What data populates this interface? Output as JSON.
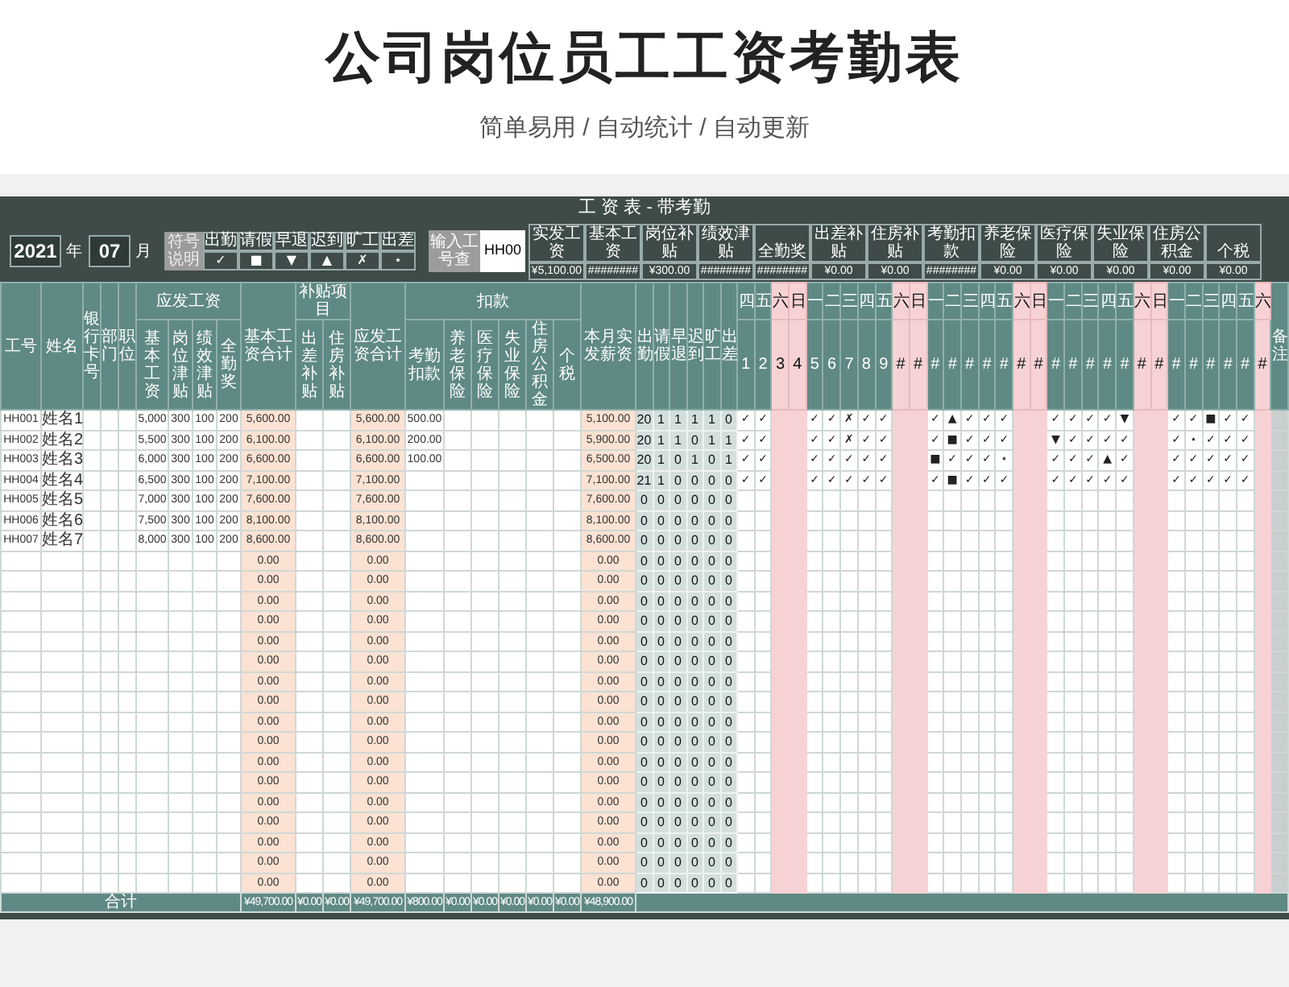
{
  "page_title": "公司岗位员工工资考勤表",
  "subtitle": "简单易用 / 自动统计 / 自动更新",
  "sheet": {
    "title": "工 资 表 - 带考勤",
    "year": "2021",
    "year_unit": "年",
    "month": "07",
    "month_unit": "月",
    "legend_title": "符号说明",
    "legend": [
      {
        "label": "出勤",
        "symbol": "✓"
      },
      {
        "label": "请假",
        "symbol": "■"
      },
      {
        "label": "早退",
        "symbol": "▼"
      },
      {
        "label": "迟到",
        "symbol": "▲"
      },
      {
        "label": "旷工",
        "symbol": "✗"
      },
      {
        "label": "出差",
        "symbol": "⋆"
      }
    ],
    "lookup": {
      "label": "输入工号查",
      "value": "HH00"
    },
    "summary": [
      {
        "label": "实发工资",
        "value": "¥5,100.00"
      },
      {
        "label": "基本工资",
        "value": "########"
      },
      {
        "label": "岗位补贴",
        "value": "¥300.00"
      },
      {
        "label": "绩效津贴",
        "value": "########"
      },
      {
        "label": "全勤奖",
        "value": "########"
      },
      {
        "label": "出差补贴",
        "value": "¥0.00"
      },
      {
        "label": "住房补贴",
        "value": "¥0.00"
      },
      {
        "label": "考勤扣款",
        "value": "########"
      },
      {
        "label": "养老保险",
        "value": "¥0.00"
      },
      {
        "label": "医疗保险",
        "value": "¥0.00"
      },
      {
        "label": "失业保险",
        "value": "¥0.00"
      },
      {
        "label": "住房公积金",
        "value": "¥0.00"
      },
      {
        "label": "个税",
        "value": "¥0.00"
      }
    ],
    "columns": [
      {
        "label": "工号",
        "kind": "plain"
      },
      {
        "label": "姓名",
        "kind": "plain"
      },
      {
        "label": "银行卡号",
        "kind": "plain"
      },
      {
        "label": "部门",
        "kind": "plain"
      },
      {
        "label": "职位",
        "kind": "plain"
      },
      {
        "label": "应发工资",
        "kind": "group",
        "columns": [
          {
            "label": "基本工资",
            "kind": "plain"
          },
          {
            "label": "岗位津贴",
            "kind": "plain"
          },
          {
            "label": "绩效津贴",
            "kind": "plain"
          },
          {
            "label": "全勤奖",
            "kind": "plain"
          }
        ]
      },
      {
        "label": "基本工资合计",
        "kind": "total"
      },
      {
        "label": "补贴项目",
        "kind": "group",
        "columns": [
          {
            "label": "出差补贴",
            "kind": "plain"
          },
          {
            "label": "住房补贴",
            "kind": "plain"
          }
        ]
      },
      {
        "label": "应发工资合计",
        "kind": "total"
      },
      {
        "label": "扣款",
        "kind": "group",
        "columns": [
          {
            "label": "考勤扣款",
            "kind": "plain"
          },
          {
            "label": "养老保险",
            "kind": "plain"
          },
          {
            "label": "医疗保险",
            "kind": "plain"
          },
          {
            "label": "失业保险",
            "kind": "plain"
          },
          {
            "label": "住房公积金",
            "kind": "plain"
          },
          {
            "label": "个税",
            "kind": "plain"
          }
        ]
      },
      {
        "label": "本月实发薪资",
        "kind": "total"
      }
    ],
    "count_columns": [
      {
        "label": "出勤"
      },
      {
        "label": "请假"
      },
      {
        "label": "早退"
      },
      {
        "label": "迟到"
      },
      {
        "label": "旷工"
      },
      {
        "label": "出差"
      }
    ],
    "days": [
      {
        "weekday": "四",
        "day": "1",
        "weekend": false
      },
      {
        "weekday": "五",
        "day": "2",
        "weekend": false
      },
      {
        "weekday": "六",
        "day": "3",
        "weekend": true
      },
      {
        "weekday": "日",
        "day": "4",
        "weekend": true
      },
      {
        "weekday": "一",
        "day": "5",
        "weekend": false
      },
      {
        "weekday": "二",
        "day": "6",
        "weekend": false
      },
      {
        "weekday": "三",
        "day": "7",
        "weekend": false
      },
      {
        "weekday": "四",
        "day": "8",
        "weekend": false
      },
      {
        "weekday": "五",
        "day": "9",
        "weekend": false
      },
      {
        "weekday": "六",
        "day": "#",
        "weekend": true
      },
      {
        "weekday": "日",
        "day": "#",
        "weekend": true
      },
      {
        "weekday": "一",
        "day": "#",
        "weekend": false
      },
      {
        "weekday": "二",
        "day": "#",
        "weekend": false
      },
      {
        "weekday": "三",
        "day": "#",
        "weekend": false
      },
      {
        "weekday": "四",
        "day": "#",
        "weekend": false
      },
      {
        "weekday": "五",
        "day": "#",
        "weekend": false
      },
      {
        "weekday": "六",
        "day": "#",
        "weekend": true
      },
      {
        "weekday": "日",
        "day": "#",
        "weekend": true
      },
      {
        "weekday": "一",
        "day": "#",
        "weekend": false
      },
      {
        "weekday": "二",
        "day": "#",
        "weekend": false
      },
      {
        "weekday": "三",
        "day": "#",
        "weekend": false
      },
      {
        "weekday": "四",
        "day": "#",
        "weekend": false
      },
      {
        "weekday": "五",
        "day": "#",
        "weekend": false
      },
      {
        "weekday": "六",
        "day": "#",
        "weekend": true
      },
      {
        "weekday": "日",
        "day": "#",
        "weekend": true
      },
      {
        "weekday": "一",
        "day": "#",
        "weekend": false
      },
      {
        "weekday": "二",
        "day": "#",
        "weekend": false
      },
      {
        "weekday": "三",
        "day": "#",
        "weekend": false
      },
      {
        "weekday": "四",
        "day": "#",
        "weekend": false
      },
      {
        "weekday": "五",
        "day": "#",
        "weekend": false
      },
      {
        "weekday": "六",
        "day": "#",
        "weekend": true
      }
    ],
    "note_header": "备注",
    "rows": [
      {
        "id": "HH001",
        "name": "姓名1",
        "base": "5,000",
        "post": "300",
        "perf": "100",
        "full": "200",
        "base_total": "5,600.00",
        "gross_total": "5,600.00",
        "attendance_deduction": "500.00",
        "net_pay": "5,100.00",
        "counts": [
          "20",
          "1",
          "1",
          "1",
          "1",
          "0"
        ],
        "workday_marks": [
          "✓",
          "✓",
          "✓",
          "✓",
          "✗",
          "✓",
          "✓",
          "✓",
          "▲",
          "✓",
          "✓",
          "✓",
          "✓",
          "✓",
          "✓",
          "✓",
          "▼",
          "✓",
          "✓",
          "■",
          "✓",
          "✓"
        ]
      },
      {
        "id": "HH002",
        "name": "姓名2",
        "base": "5,500",
        "post": "300",
        "perf": "100",
        "full": "200",
        "base_total": "6,100.00",
        "gross_total": "6,100.00",
        "attendance_deduction": "200.00",
        "net_pay": "5,900.00",
        "counts": [
          "20",
          "1",
          "1",
          "0",
          "1",
          "1"
        ],
        "workday_marks": [
          "✓",
          "✓",
          "✓",
          "✓",
          "✗",
          "✓",
          "✓",
          "✓",
          "■",
          "✓",
          "✓",
          "✓",
          "▼",
          "✓",
          "✓",
          "✓",
          "✓",
          "✓",
          "⋆",
          "✓",
          "✓",
          "✓"
        ]
      },
      {
        "id": "HH003",
        "name": "姓名3",
        "base": "6,000",
        "post": "300",
        "perf": "100",
        "full": "200",
        "base_total": "6,600.00",
        "gross_total": "6,600.00",
        "attendance_deduction": "100.00",
        "net_pay": "6,500.00",
        "counts": [
          "20",
          "1",
          "0",
          "1",
          "0",
          "1"
        ],
        "workday_marks": [
          "✓",
          "✓",
          "✓",
          "✓",
          "✓",
          "✓",
          "✓",
          "■",
          "✓",
          "✓",
          "✓",
          "⋆",
          "✓",
          "✓",
          "✓",
          "▲",
          "✓",
          "✓",
          "✓",
          "✓",
          "✓",
          "✓"
        ]
      },
      {
        "id": "HH004",
        "name": "姓名4",
        "base": "6,500",
        "post": "300",
        "perf": "100",
        "full": "200",
        "base_total": "7,100.00",
        "gross_total": "7,100.00",
        "net_pay": "7,100.00",
        "counts": [
          "21",
          "1",
          "0",
          "0",
          "0",
          "0"
        ],
        "workday_marks": [
          "✓",
          "✓",
          "✓",
          "✓",
          "✓",
          "✓",
          "✓",
          "✓",
          "■",
          "✓",
          "✓",
          "✓",
          "✓",
          "✓",
          "✓",
          "✓",
          "✓",
          "✓",
          "✓",
          "✓",
          "✓",
          "✓"
        ]
      },
      {
        "id": "HH005",
        "name": "姓名5",
        "base": "7,000",
        "post": "300",
        "perf": "100",
        "full": "200",
        "base_total": "7,600.00",
        "gross_total": "7,600.00",
        "net_pay": "7,600.00",
        "counts": [
          "0",
          "0",
          "0",
          "0",
          "0",
          "0"
        ]
      },
      {
        "id": "HH006",
        "name": "姓名6",
        "base": "7,500",
        "post": "300",
        "perf": "100",
        "full": "200",
        "base_total": "8,100.00",
        "gross_total": "8,100.00",
        "net_pay": "8,100.00",
        "counts": [
          "0",
          "0",
          "0",
          "0",
          "0",
          "0"
        ]
      },
      {
        "id": "HH007",
        "name": "姓名7",
        "base": "8,000",
        "post": "300",
        "perf": "100",
        "full": "200",
        "base_total": "8,600.00",
        "gross_total": "8,600.00",
        "net_pay": "8,600.00",
        "counts": [
          "0",
          "0",
          "0",
          "0",
          "0",
          "0"
        ]
      },
      {
        "base_total": "0.00",
        "gross_total": "0.00",
        "net_pay": "0.00",
        "counts": [
          "0",
          "0",
          "0",
          "0",
          "0",
          "0"
        ]
      },
      {
        "base_total": "0.00",
        "gross_total": "0.00",
        "net_pay": "0.00",
        "counts": [
          "0",
          "0",
          "0",
          "0",
          "0",
          "0"
        ]
      },
      {
        "base_total": "0.00",
        "gross_total": "0.00",
        "net_pay": "0.00",
        "counts": [
          "0",
          "0",
          "0",
          "0",
          "0",
          "0"
        ]
      },
      {
        "base_total": "0.00",
        "gross_total": "0.00",
        "net_pay": "0.00",
        "counts": [
          "0",
          "0",
          "0",
          "0",
          "0",
          "0"
        ]
      },
      {
        "base_total": "0.00",
        "gross_total": "0.00",
        "net_pay": "0.00",
        "counts": [
          "0",
          "0",
          "0",
          "0",
          "0",
          "0"
        ]
      },
      {
        "base_total": "0.00",
        "gross_total": "0.00",
        "net_pay": "0.00",
        "counts": [
          "0",
          "0",
          "0",
          "0",
          "0",
          "0"
        ]
      },
      {
        "base_total": "0.00",
        "gross_total": "0.00",
        "net_pay": "0.00",
        "counts": [
          "0",
          "0",
          "0",
          "0",
          "0",
          "0"
        ]
      },
      {
        "base_total": "0.00",
        "gross_total": "0.00",
        "net_pay": "0.00",
        "counts": [
          "0",
          "0",
          "0",
          "0",
          "0",
          "0"
        ]
      },
      {
        "base_total": "0.00",
        "gross_total": "0.00",
        "net_pay": "0.00",
        "counts": [
          "0",
          "0",
          "0",
          "0",
          "0",
          "0"
        ]
      },
      {
        "base_total": "0.00",
        "gross_total": "0.00",
        "net_pay": "0.00",
        "counts": [
          "0",
          "0",
          "0",
          "0",
          "0",
          "0"
        ]
      },
      {
        "base_total": "0.00",
        "gross_total": "0.00",
        "net_pay": "0.00",
        "counts": [
          "0",
          "0",
          "0",
          "0",
          "0",
          "0"
        ]
      },
      {
        "base_total": "0.00",
        "gross_total": "0.00",
        "net_pay": "0.00",
        "counts": [
          "0",
          "0",
          "0",
          "0",
          "0",
          "0"
        ]
      },
      {
        "base_total": "0.00",
        "gross_total": "0.00",
        "net_pay": "0.00",
        "counts": [
          "0",
          "0",
          "0",
          "0",
          "0",
          "0"
        ]
      },
      {
        "base_total": "0.00",
        "gross_total": "0.00",
        "net_pay": "0.00",
        "counts": [
          "0",
          "0",
          "0",
          "0",
          "0",
          "0"
        ]
      },
      {
        "base_total": "0.00",
        "gross_total": "0.00",
        "net_pay": "0.00",
        "counts": [
          "0",
          "0",
          "0",
          "0",
          "0",
          "0"
        ]
      },
      {
        "base_total": "0.00",
        "gross_total": "0.00",
        "net_pay": "0.00",
        "counts": [
          "0",
          "0",
          "0",
          "0",
          "0",
          "0"
        ]
      },
      {
        "base_total": "0.00",
        "gross_total": "0.00",
        "net_pay": "0.00",
        "counts": [
          "0",
          "0",
          "0",
          "0",
          "0",
          "0"
        ]
      }
    ],
    "total": {
      "label": "合计",
      "cells": [
        "¥49,700.00",
        "¥0.00",
        "¥0.00",
        "¥49,700.00",
        "¥800.00",
        "¥0.00",
        "¥0.00",
        "¥0.00",
        "¥0.00",
        "¥0.00",
        "¥48,900.00"
      ]
    }
  }
}
